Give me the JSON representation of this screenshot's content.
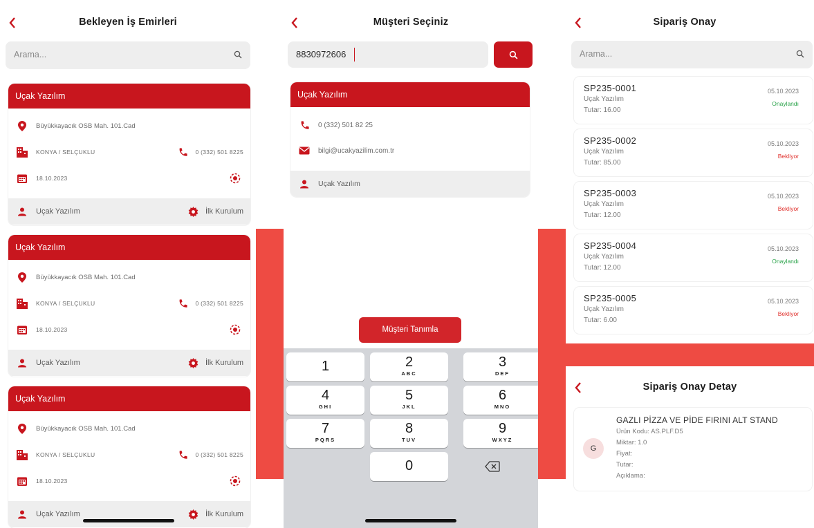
{
  "colors": {
    "brand_red": "#c8161e",
    "band_red": "#ee4b43",
    "approved_green": "#2aa34a",
    "pending_red": "#e0322e",
    "keypad_bg": "#d3d5d9"
  },
  "screen1": {
    "title": "Bekleyen İş Emirleri",
    "search_placeholder": "Arama...",
    "cards": [
      {
        "company": "Uçak Yazılım",
        "address": "Büyükkayacık OSB Mah. 101.Cad",
        "city": "KONYA / SELÇUKLU",
        "phone": "0 (332) 501 8225",
        "date": "18.10.2023",
        "person": "Uçak Yazılım",
        "task": "İlk Kurulum"
      },
      {
        "company": "Uçak Yazılım",
        "address": "Büyükkayacık OSB Mah. 101.Cad",
        "city": "KONYA / SELÇUKLU",
        "phone": "0 (332) 501 8225",
        "date": "18.10.2023",
        "person": "Uçak Yazılım",
        "task": "İlk Kurulum"
      },
      {
        "company": "Uçak Yazılım",
        "address": "Büyükkayacık OSB Mah. 101.Cad",
        "city": "KONYA / SELÇUKLU",
        "phone": "0 (332) 501 8225",
        "date": "18.10.2023",
        "person": "Uçak Yazılım",
        "task": "İlk Kurulum"
      }
    ]
  },
  "screen2": {
    "title": "Müşteri Seçiniz",
    "phone_input_value": "8830972606",
    "customer": {
      "company": "Uçak Yazılım",
      "phone": "0 (332) 501 82 25",
      "email": "bilgi@ucakyazilim.com.tr",
      "person": "Uçak Yazılım"
    },
    "define_button": "Müşteri Tanımla",
    "keypad": [
      {
        "n": "1",
        "l": ""
      },
      {
        "n": "2",
        "l": "ABC"
      },
      {
        "n": "3",
        "l": "DEF"
      },
      {
        "n": "4",
        "l": "GHI"
      },
      {
        "n": "5",
        "l": "JKL"
      },
      {
        "n": "6",
        "l": "MNO"
      },
      {
        "n": "7",
        "l": "PQRS"
      },
      {
        "n": "8",
        "l": "TUV"
      },
      {
        "n": "9",
        "l": "WXYZ"
      },
      {
        "n": "0",
        "l": ""
      }
    ]
  },
  "screen3": {
    "title": "Sipariş Onay",
    "search_placeholder": "Arama...",
    "orders": [
      {
        "code": "SP235-0001",
        "company": "Uçak Yazılım",
        "amount": "Tutar: 16.00",
        "date": "05.10.2023",
        "status": "Onaylandı",
        "status_type": "approved"
      },
      {
        "code": "SP235-0002",
        "company": "Uçak Yazılım",
        "amount": "Tutar: 85.00",
        "date": "05.10.2023",
        "status": "Bekliyor",
        "status_type": "pending"
      },
      {
        "code": "SP235-0003",
        "company": "Uçak Yazılım",
        "amount": "Tutar: 12.00",
        "date": "05.10.2023",
        "status": "Bekliyor",
        "status_type": "pending"
      },
      {
        "code": "SP235-0004",
        "company": "Uçak Yazılım",
        "amount": "Tutar: 12.00",
        "date": "05.10.2023",
        "status": "Onaylandı",
        "status_type": "approved"
      },
      {
        "code": "SP235-0005",
        "company": "Uçak Yazılım",
        "amount": "Tutar: 6.00",
        "date": "05.10.2023",
        "status": "Bekliyor",
        "status_type": "pending"
      }
    ]
  },
  "screen4": {
    "title": "Sipariş Onay Detay",
    "avatar_letter": "G",
    "product_name": "GAZLI PİZZA VE PİDE FIRINI ALT STAND",
    "product_code": "Ürün Kodu: AS.PLF.D5",
    "quantity": "Miktar: 1.0",
    "price": "Fiyat:",
    "total": "Tutar:",
    "note": "Açıklama:"
  }
}
